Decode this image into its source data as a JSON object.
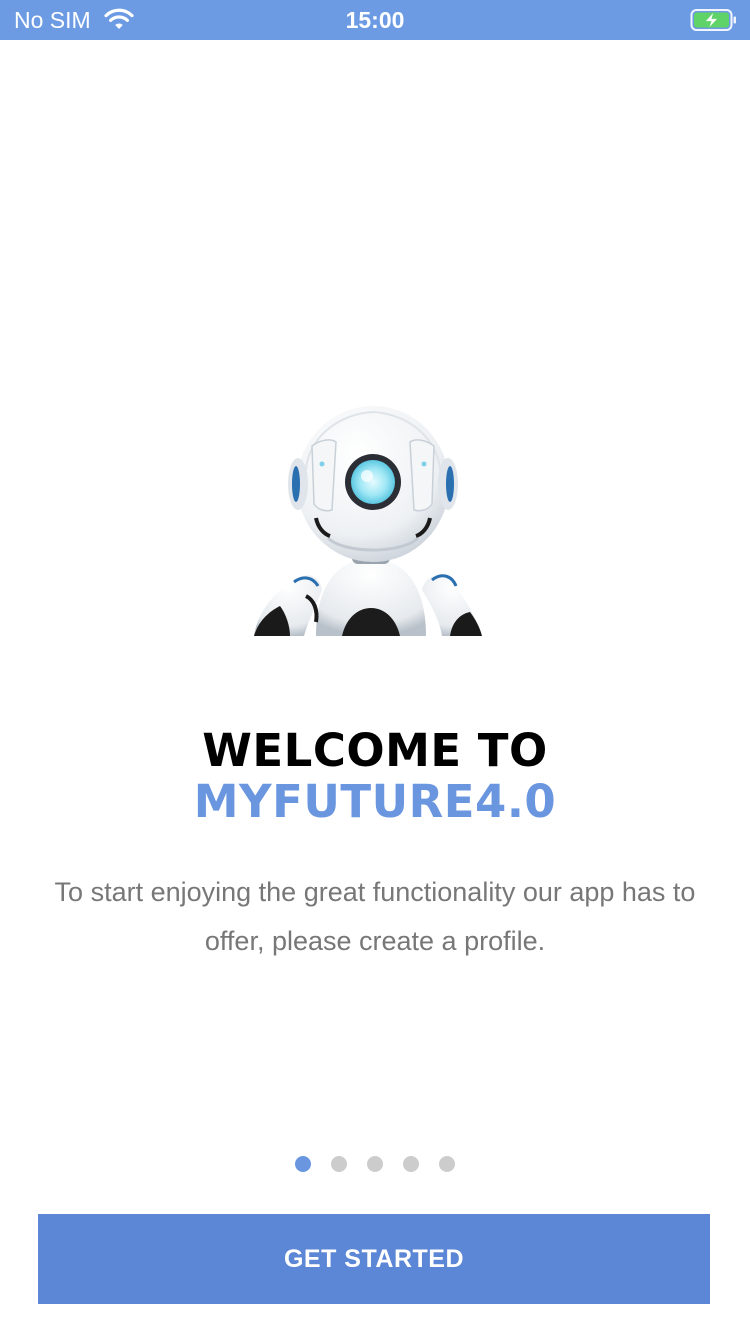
{
  "status_bar": {
    "carrier": "No SIM",
    "time": "15:00",
    "icons": [
      "wifi-icon",
      "battery-charging-icon"
    ],
    "background_color": "#6c9be4"
  },
  "onboarding": {
    "illustration": "robot-illustration",
    "title_line1": "WELCOME TO",
    "title_line2": "MYFUTURE4.0",
    "description": "To start enjoying the great functionality our app has to offer, please create a profile.",
    "pager": {
      "total_pages": 5,
      "current_page": 1
    }
  },
  "actions": {
    "get_started_label": "GET STARTED"
  },
  "colors": {
    "accent": "#6a96e0",
    "button": "#5b87d6",
    "dot_inactive": "#cccccc",
    "description_text": "#777777"
  }
}
